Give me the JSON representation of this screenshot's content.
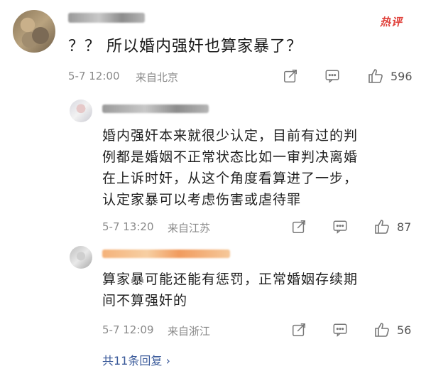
{
  "hot_tag": "热评",
  "main_comment": {
    "text": "？？ 所以婚内强奸也算家暴了？",
    "timestamp": "5-7 12:00",
    "location": "来自北京",
    "likes": "596"
  },
  "replies": [
    {
      "lines": [
        "婚内强奸本来就很少认定，目前有过的判",
        "例都是婚姻不正常状态比如一审判决离婚",
        "在上诉时奸，从这个角度看算进了一步，",
        "认定家暴可以考虑伤害或虐待罪"
      ],
      "timestamp": "5-7 13:20",
      "location": "来自江苏",
      "likes": "87"
    },
    {
      "lines": [
        "算家暴可能还能有惩罚，正常婚姻存续期",
        "间不算强奸的"
      ],
      "timestamp": "5-7 12:09",
      "location": "来自浙江",
      "likes": "56"
    }
  ],
  "more_replies": "共11条回复 ›",
  "colors": {
    "hot": "#e0403a",
    "link": "#3a5a9a",
    "meta": "#8a8a8a"
  },
  "icons": [
    "share-icon",
    "comment-icon",
    "like-icon"
  ]
}
